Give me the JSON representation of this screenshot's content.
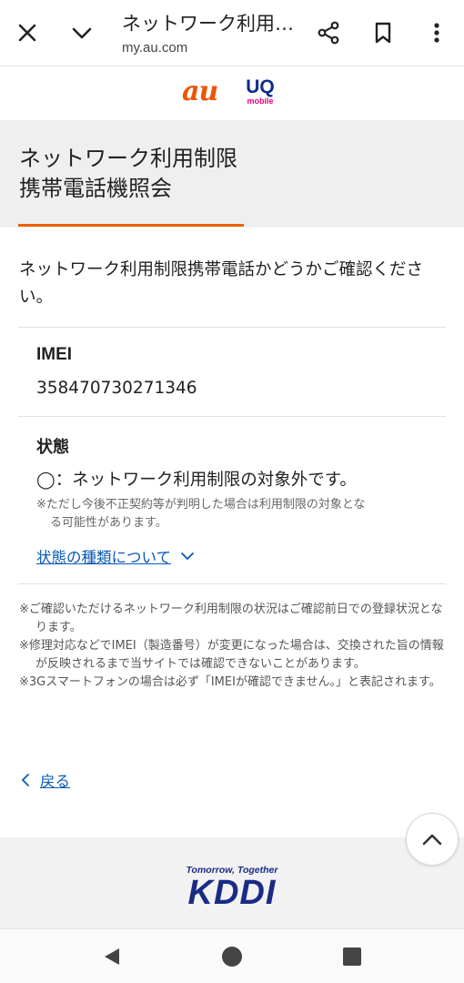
{
  "browser": {
    "page_title": "ネットワーク利用制限携帯電話機照会",
    "url": "my.au.com",
    "icons": [
      "close-icon",
      "chevron-down-icon",
      "share-icon",
      "bookmark-icon",
      "more-vert-icon"
    ]
  },
  "logos": {
    "au": "au",
    "uq_main": "UQ",
    "uq_sub": "mobile"
  },
  "header": {
    "title_line1": "ネットワーク利用制限",
    "title_line2": "携帯電話機照会",
    "accent_color": "#eb6100"
  },
  "main": {
    "intro": "ネットワーク利用制限携帯電話かどうかご確認ください。",
    "imei_label": "IMEI",
    "imei_value": "358470730271346",
    "status_label": "状態",
    "status_text": "◯：ネットワーク利用制限の対象外です。",
    "status_note_line1": "※ただし今後不正契約等が判明した場合は利用制限の対象とな",
    "status_note_line2": "る可能性があります。",
    "status_types_link": "状態の種類について"
  },
  "notes": [
    "※ご確認いただけるネットワーク利用制限の状況はご確認前日での登録状況となります。",
    "※修理対応などでIMEI（製造番号）が変更になった場合は、交換された旨の情報が反映されるまで当サイトでは確認できないことがあります。",
    "※3Gスマートフォンの場合は必ず「IMEIが確認できません。」と表記されます。"
  ],
  "back_link": "戻る",
  "footer": {
    "tagline": "Tomorrow, Together",
    "brand": "KDDI"
  }
}
